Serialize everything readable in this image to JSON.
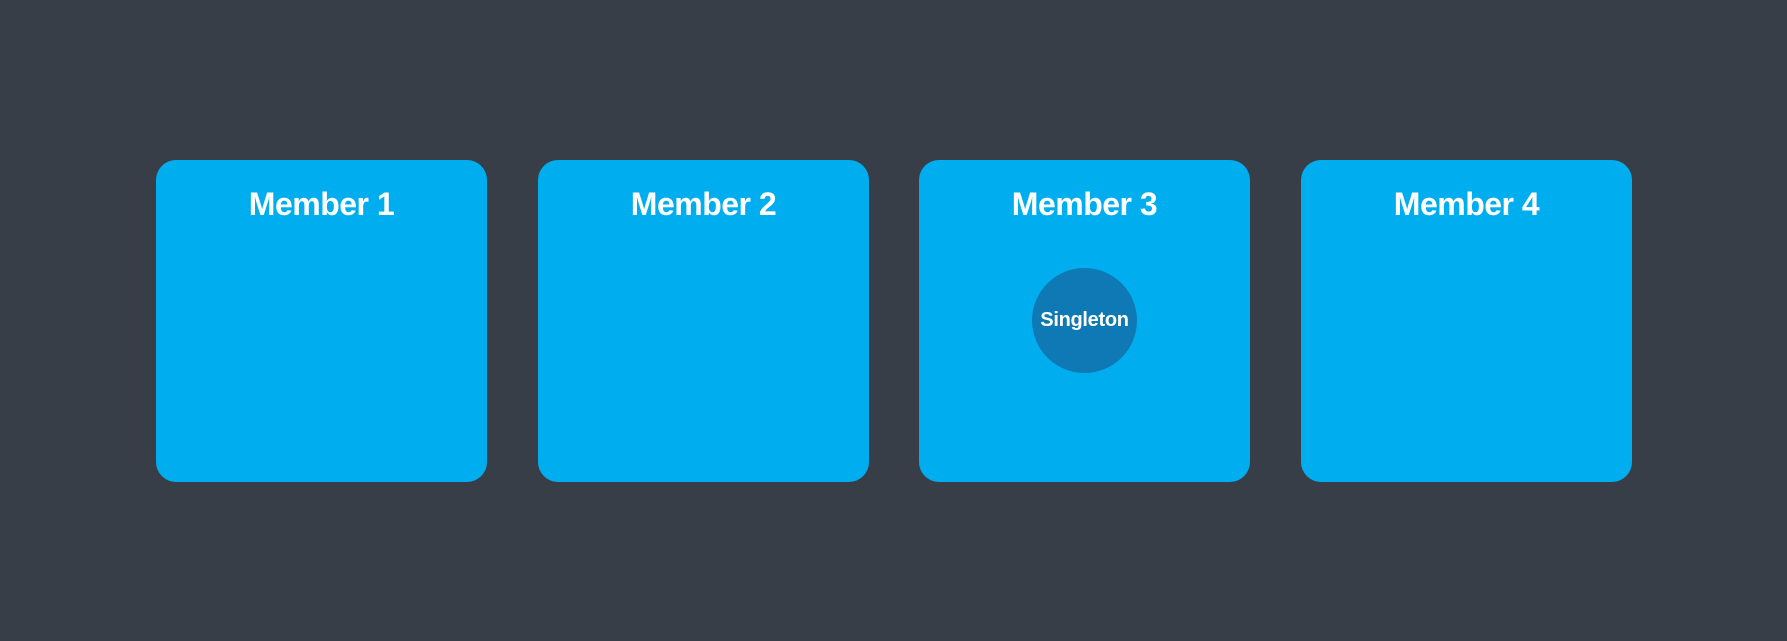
{
  "colors": {
    "background": "#373e48",
    "card": "#00aeef",
    "singleton": "#0e79b4",
    "text": "#ffffff"
  },
  "members": [
    {
      "label": "Member 1"
    },
    {
      "label": "Member 2"
    },
    {
      "label": "Member 3",
      "child": "Singleton"
    },
    {
      "label": "Member 4"
    }
  ]
}
